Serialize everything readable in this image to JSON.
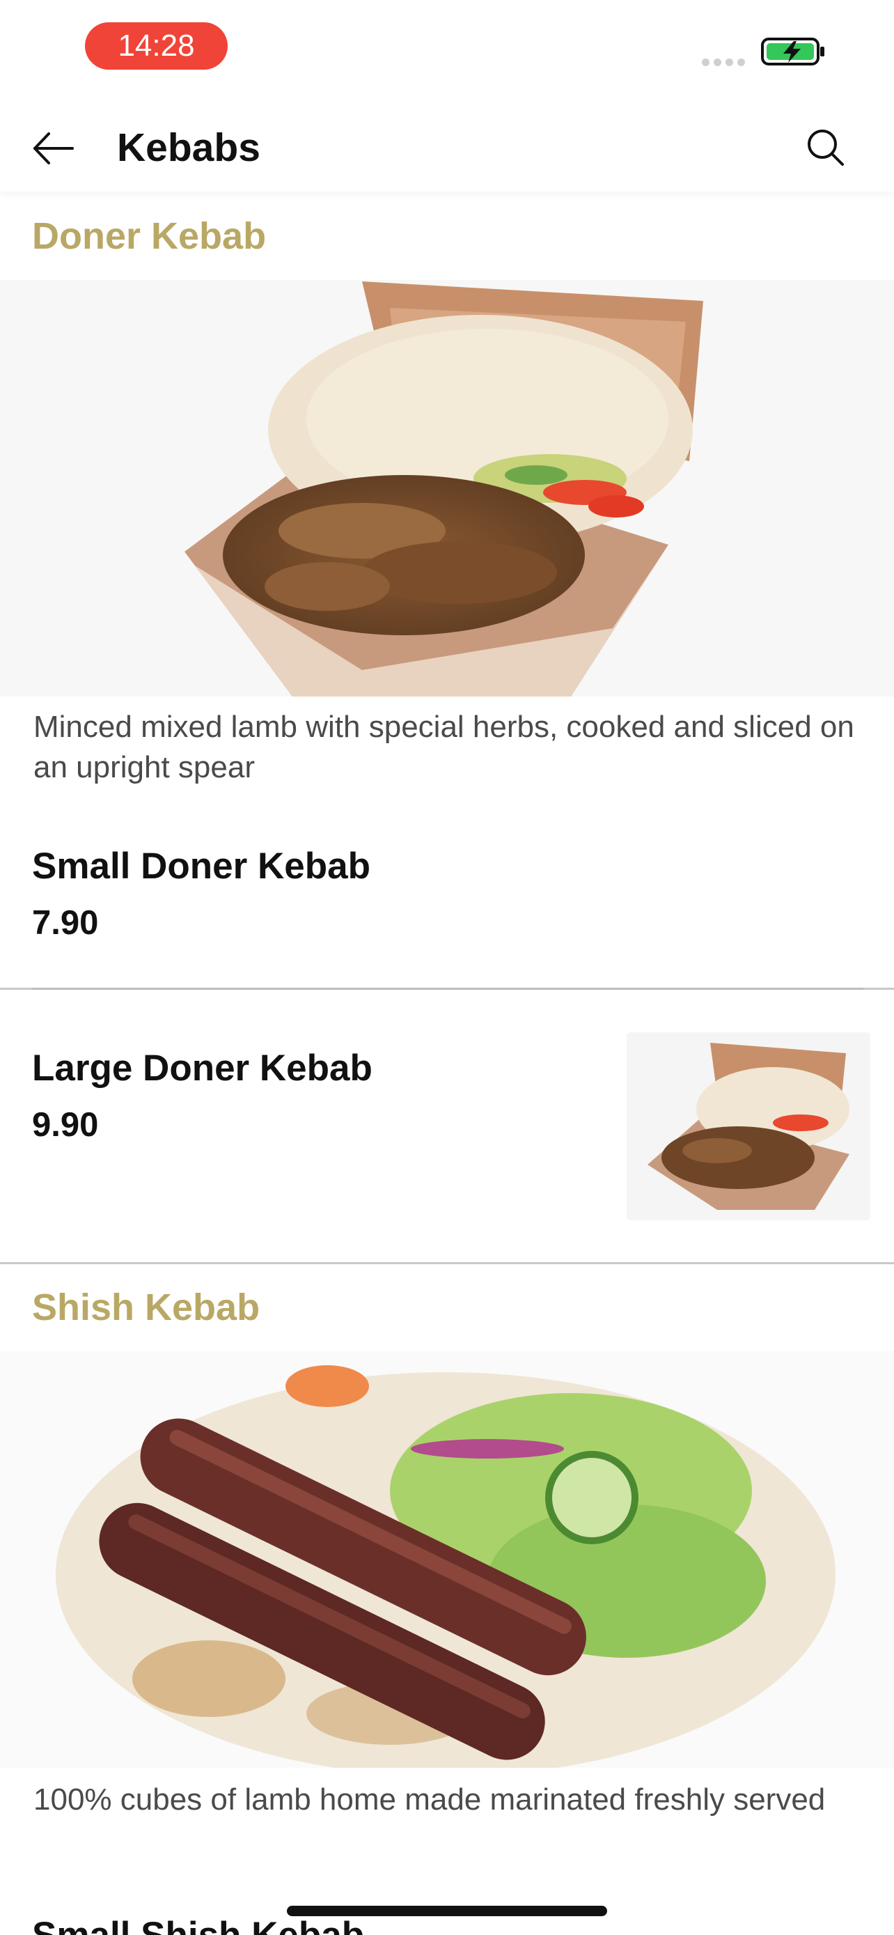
{
  "status_bar": {
    "time": "14:28",
    "battery_icon": "battery-charging-icon",
    "colors": {
      "time_pill": "#f04438",
      "battery": "#34c759"
    }
  },
  "nav": {
    "title": "Kebabs",
    "back_icon": "arrow-left-icon",
    "search_icon": "search-icon"
  },
  "sections": [
    {
      "title": "Doner Kebab",
      "image": "doner-kebab-box-image",
      "description": "Minced mixed lamb with special herbs, cooked and sliced on an upright spear",
      "items": [
        {
          "name": "Small Doner Kebab",
          "price": "7.90"
        },
        {
          "name": "Large Doner Kebab",
          "price": "9.90",
          "image": "doner-kebab-thumbnail"
        }
      ]
    },
    {
      "title": "Shish Kebab",
      "image": "shish-kebab-image",
      "description": "100% cubes of lamb home made marinated freshly served",
      "items": [
        {
          "name": "Small Shish Kebab",
          "price": ""
        }
      ]
    }
  ],
  "colors": {
    "section_title": "#b9a865",
    "divider": "#c9c9c9"
  }
}
